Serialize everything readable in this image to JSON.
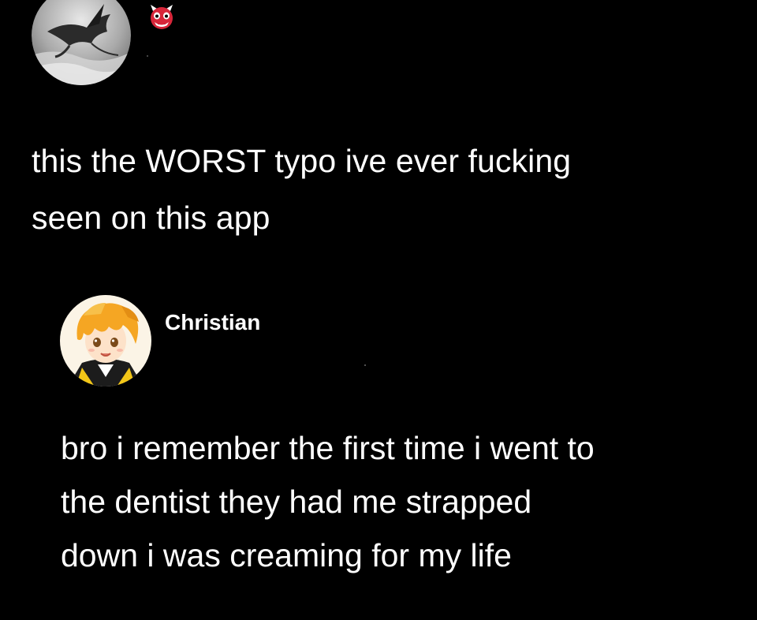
{
  "post": {
    "avatar_icon": "dragon-avatar",
    "badge_icon": "ogre-emoji",
    "text_lines": [
      "this the WORST typo ive ever fucking",
      "seen on this app"
    ]
  },
  "reply": {
    "avatar_icon": "anime-character-avatar",
    "author": "Christian",
    "text_lines": [
      "bro i remember the first time i went to",
      "the dentist they had me strapped",
      "down i was creaming for my life"
    ]
  },
  "colors": {
    "background": "#000000",
    "text": "#ffffff",
    "badge_red": "#d8263a"
  }
}
